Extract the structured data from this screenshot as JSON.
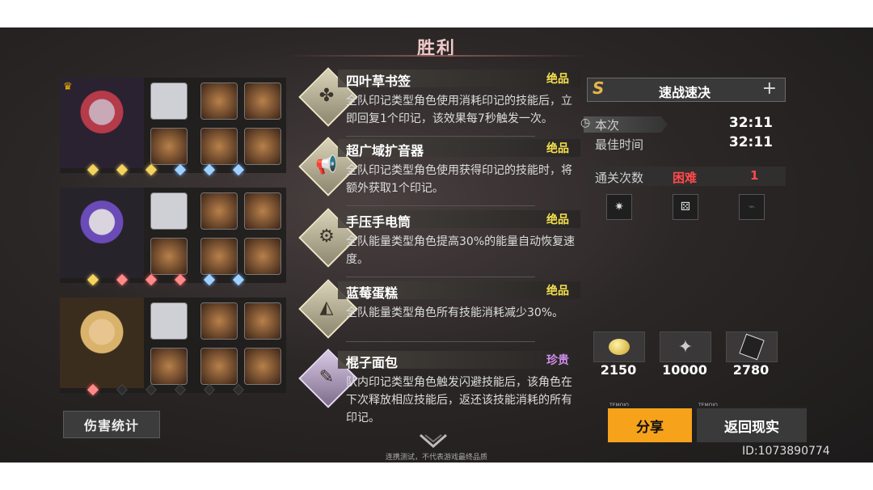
{
  "header": {
    "title": "胜利"
  },
  "team": [
    {
      "portrait_colors": [
        "#2a2230",
        "#c8a9b6",
        "#b53a4a"
      ],
      "equips": [
        "portrait-icon",
        "compass-icon",
        "sun-crest-icon",
        "crossed-swords-icon",
        "lion-crest-icon",
        "goblet-icon"
      ],
      "stars": [
        "gold",
        "gold",
        "gold",
        "blue",
        "blue",
        "blue"
      ]
    },
    {
      "portrait_colors": [
        "#26232b",
        "#d9d4dd",
        "#6a4bb8"
      ],
      "equips": [
        "portrait-icon",
        "helmet-icon",
        "mask-icon",
        "tree-icon",
        "rose-icon",
        "gear-icon"
      ],
      "stars": [
        "gold",
        "red",
        "red",
        "red",
        "blue",
        "blue"
      ]
    },
    {
      "portrait_colors": [
        "#3a2d1d",
        "#e8c58f",
        "#d9b36b"
      ],
      "equips": [
        "portrait-icon",
        "sunburst-icon",
        "scarab-icon",
        "orb-icon",
        "lion-crest-icon",
        "ring-icon"
      ],
      "stars": [
        "red",
        "dim",
        "dim",
        "dim",
        "dim",
        "dim"
      ]
    }
  ],
  "damage_button": "伤害统计",
  "relics": [
    {
      "name": "四叶草书签",
      "rarity": "绝品",
      "desc": "全队印记类型角色使用消耗印记的技能后，立即回复1个印记，该效果每7秒触发一次。",
      "glyph": "✤"
    },
    {
      "name": "超广域扩音器",
      "rarity": "绝品",
      "desc": "全队印记类型角色使用获得印记的技能时，将额外获取1个印记。",
      "glyph": "📢"
    },
    {
      "name": "手压手电筒",
      "rarity": "绝品",
      "desc": "全队能量类型角色提高30%的能量自动恢复速度。",
      "glyph": "⚙"
    },
    {
      "name": "蓝莓蛋糕",
      "rarity": "绝品",
      "desc": "全队能量类型角色所有技能消耗减少30%。",
      "glyph": "◭"
    },
    {
      "name": "棍子面包",
      "rarity": "珍贵",
      "desc": "队内印记类型角色触发闪避技能后，该角色在下次释放相应技能后，返还该技能消耗的所有印记。",
      "glyph": "✎"
    }
  ],
  "colors": {
    "rarity_top": "#f4e04d",
    "rarity_precious": "#d48ef0",
    "accent": "#f7a21b",
    "hard": "#ff4a4a"
  },
  "mode": {
    "badge": "S",
    "name": "速战速决",
    "plus": "+"
  },
  "stats": {
    "this_label": "本次",
    "this_value": "32:11",
    "best_label": "最佳时间",
    "best_value": "32:11",
    "clear_label": "通关次数",
    "difficulty": "困难",
    "clear_count": "1"
  },
  "rating_icons": [
    "✷",
    "⚄",
    "⌁"
  ],
  "resources": [
    {
      "icon": "coin-icon",
      "value": "2150"
    },
    {
      "icon": "crystal-icon",
      "value": "10000"
    },
    {
      "icon": "card-icon",
      "value": "2780"
    }
  ],
  "buttons": {
    "share": "分享",
    "return": "返回现实",
    "tag_left": "TEMOJO",
    "tag_right": "TEMOJO"
  },
  "player_id": "ID:1073890774",
  "disclaimer": "连携测试，不代表游戏最终品质"
}
